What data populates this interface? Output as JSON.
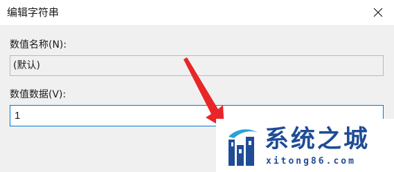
{
  "window": {
    "title": "编辑字符串",
    "close_icon": "close-icon"
  },
  "form": {
    "value_name_label": "数值名称(N):",
    "value_name": "(默认)",
    "value_data_label": "数值数据(V):",
    "value_data": "1"
  },
  "annotation": {
    "arrow_color": "#e8262a"
  },
  "watermark": {
    "brand": "系统之城",
    "domain": "xitong86.com",
    "logo_icon": "castle-logo-icon",
    "color": "#1f4c95"
  }
}
